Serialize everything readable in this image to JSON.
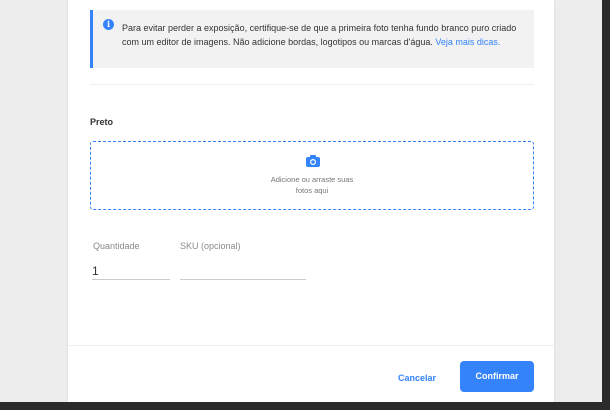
{
  "notice": {
    "text": "Para evitar perder a exposição, certifique-se de que a primeira foto tenha fundo branco puro criado com um editor de imagens. Não adicione bordas, logotipos ou marcas d'água. ",
    "link": "Veja mais dicas.",
    "icon": "info-icon"
  },
  "variant": {
    "title": "Preto"
  },
  "upload": {
    "icon": "camera-icon",
    "line1": "Adicione ou arraste suas",
    "line2": "fotos aqui"
  },
  "fields": {
    "quantity_label": "Quantidade",
    "quantity_value": "1",
    "sku_label": "SKU (opcional)",
    "sku_value": ""
  },
  "actions": {
    "cancel": "Cancelar",
    "confirm": "Confirmar"
  },
  "colors": {
    "accent": "#3483fa"
  }
}
